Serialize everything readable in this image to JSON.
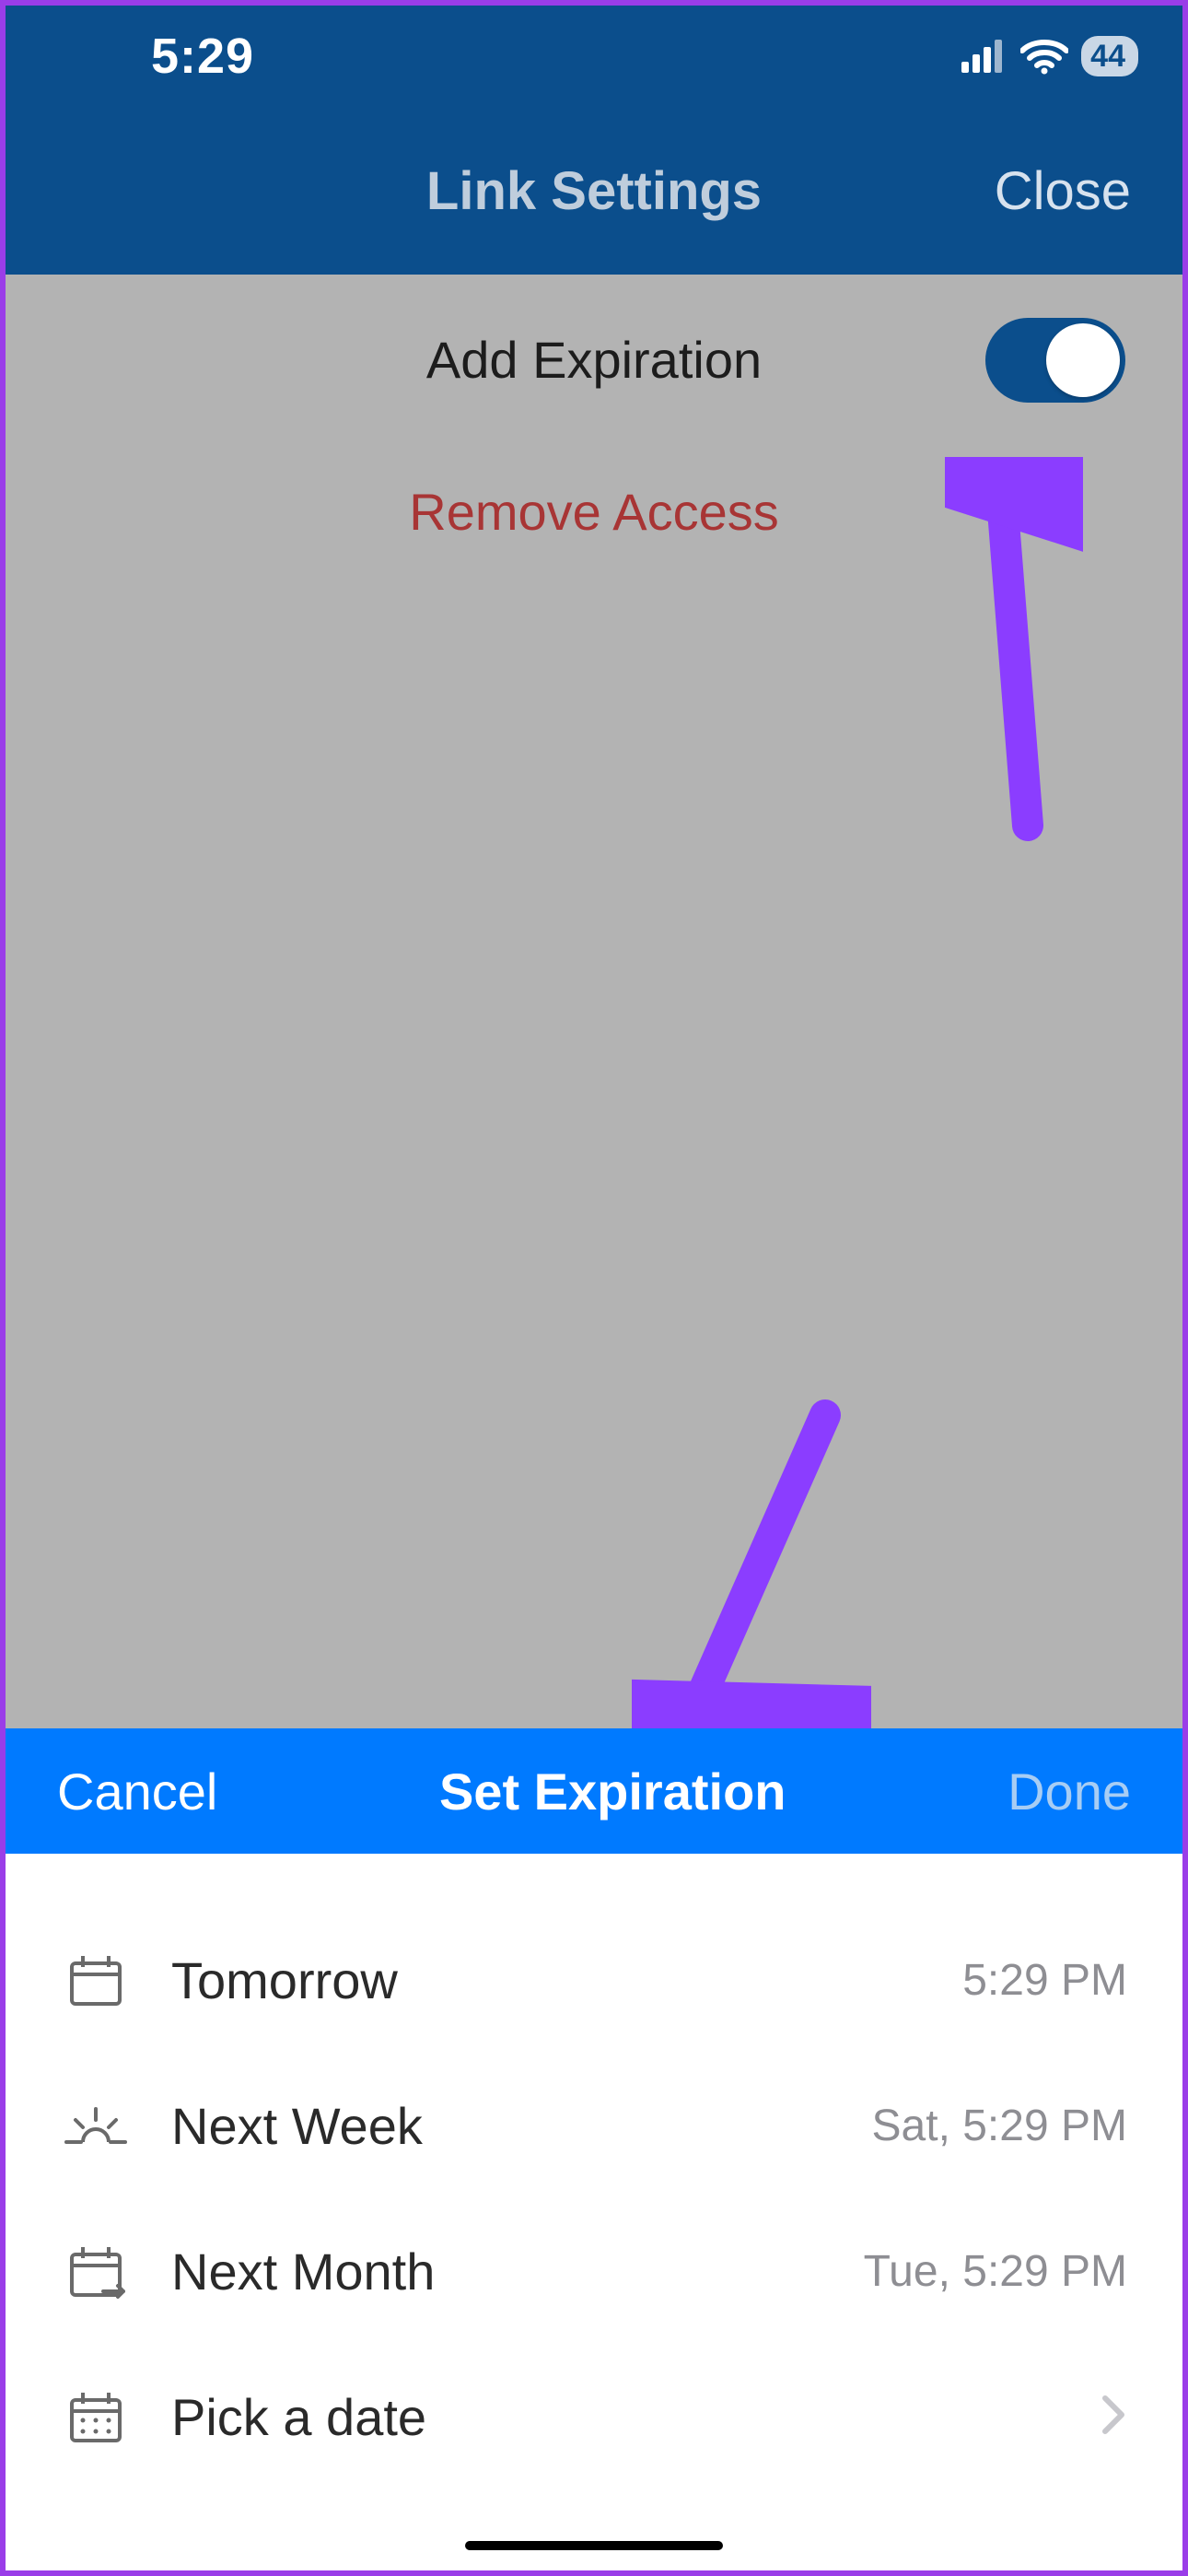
{
  "status": {
    "time": "5:29",
    "battery": "44"
  },
  "nav": {
    "title": "Link Settings",
    "close": "Close"
  },
  "settings": {
    "add_expiration_label": "Add Expiration",
    "remove_access_label": "Remove Access"
  },
  "sheet": {
    "cancel": "Cancel",
    "title": "Set Expiration",
    "done": "Done"
  },
  "options": {
    "tomorrow": {
      "label": "Tomorrow",
      "value": "5:29 PM"
    },
    "next_week": {
      "label": "Next Week",
      "value": "Sat, 5:29 PM"
    },
    "next_month": {
      "label": "Next Month",
      "value": "Tue, 5:29 PM"
    },
    "pick_date": {
      "label": "Pick a date"
    }
  },
  "colors": {
    "header_blue": "#0b4e8c",
    "sheet_blue": "#007aff",
    "danger_red": "#a83535",
    "annotation_purple": "#8b3dff"
  }
}
